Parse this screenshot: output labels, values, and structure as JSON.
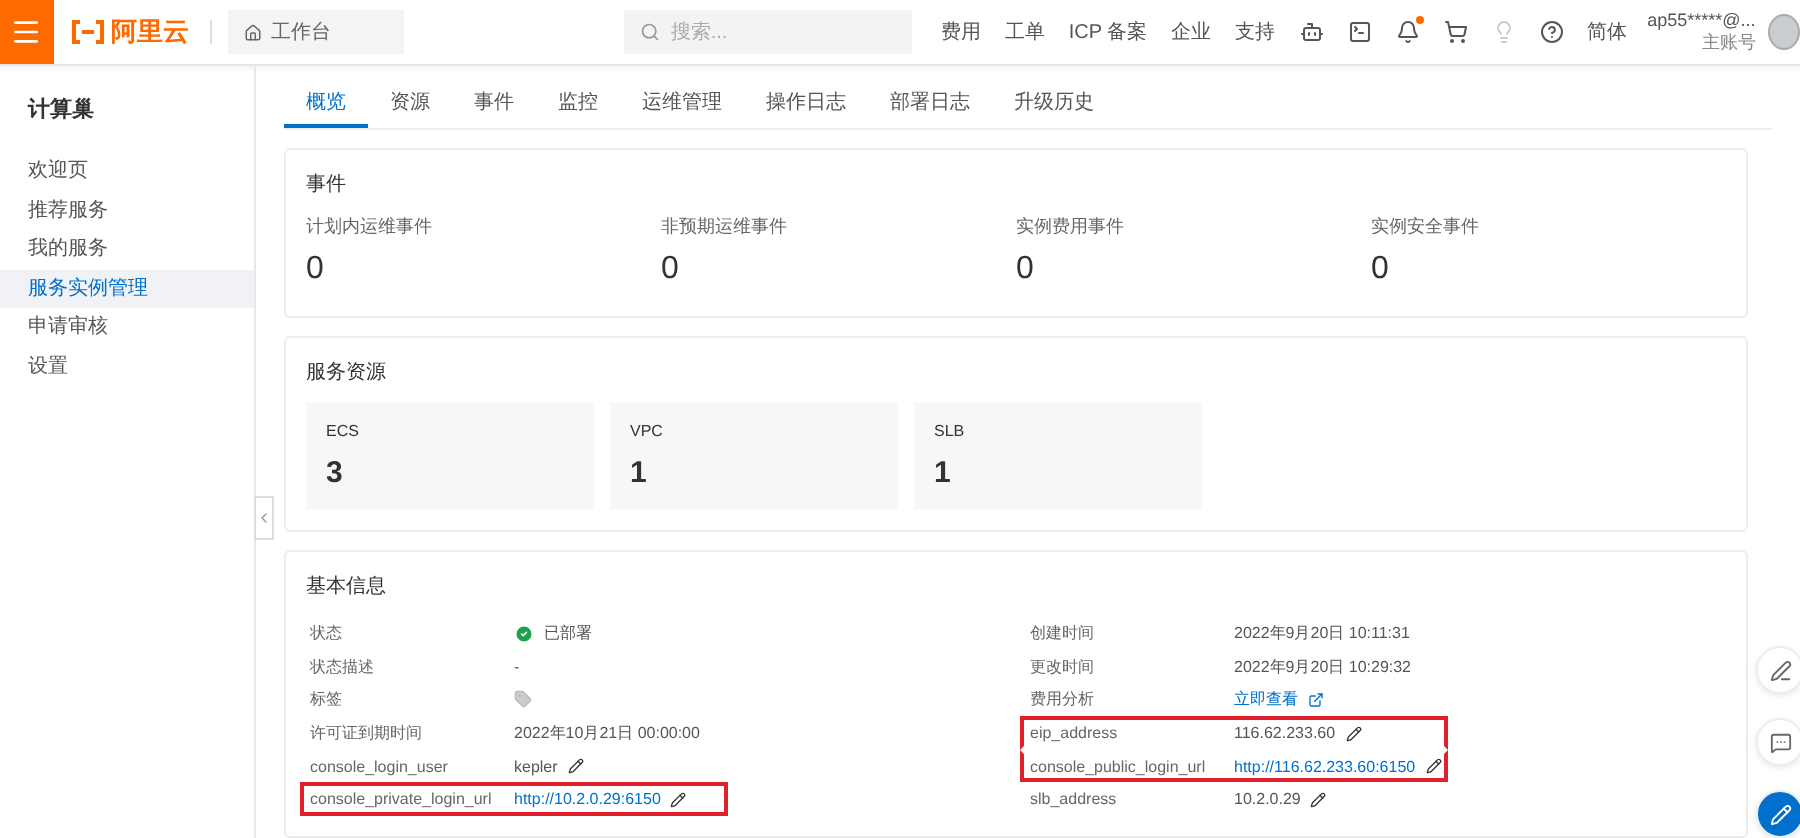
{
  "topbar": {
    "logo": "阿里云",
    "workspace": "工作台",
    "search": {
      "placeholder": "搜索..."
    },
    "nav": [
      "费用",
      "工单",
      "ICP 备案",
      "企业",
      "支持"
    ],
    "language": "简体",
    "notification_dot": true,
    "account": {
      "name": "ap55*****@...",
      "role": "主账号"
    }
  },
  "sidebar": {
    "title": "计算巢",
    "items": [
      {
        "label": "欢迎页",
        "selected": false
      },
      {
        "label": "推荐服务",
        "selected": false
      },
      {
        "label": "我的服务",
        "selected": false
      },
      {
        "label": "服务实例管理",
        "selected": true
      },
      {
        "label": "申请审核",
        "selected": false
      },
      {
        "label": "设置",
        "selected": false
      }
    ]
  },
  "tabs": [
    {
      "label": "概览",
      "selected": true
    },
    {
      "label": "资源",
      "selected": false
    },
    {
      "label": "事件",
      "selected": false
    },
    {
      "label": "监控",
      "selected": false
    },
    {
      "label": "运维管理",
      "selected": false
    },
    {
      "label": "操作日志",
      "selected": false
    },
    {
      "label": "部署日志",
      "selected": false
    },
    {
      "label": "升级历史",
      "selected": false
    }
  ],
  "events": {
    "title": "事件",
    "items": [
      {
        "label": "计划内运维事件",
        "value": "0"
      },
      {
        "label": "非预期运维事件",
        "value": "0"
      },
      {
        "label": "实例费用事件",
        "value": "0"
      },
      {
        "label": "实例安全事件",
        "value": "0"
      }
    ]
  },
  "resources": {
    "title": "服务资源",
    "items": [
      {
        "label": "ECS",
        "value": "3"
      },
      {
        "label": "VPC",
        "value": "1"
      },
      {
        "label": "SLB",
        "value": "1"
      }
    ]
  },
  "basic_info": {
    "title": "基本信息",
    "columns": [
      [
        {
          "label": "状态",
          "kind": "status",
          "value": "已部署",
          "highlighted": false
        },
        {
          "label": "状态描述",
          "kind": "text",
          "value": "-",
          "highlighted": false
        },
        {
          "label": "标签",
          "kind": "tag",
          "highlighted": false
        },
        {
          "label": "许可证到期时间",
          "kind": "text",
          "value": "2022年10月21日 00:00:00",
          "highlighted": false
        },
        {
          "label": "console_login_user",
          "kind": "editable",
          "value": "kepler",
          "highlighted": false
        },
        {
          "label": "console_private_login_url",
          "kind": "editable_link",
          "value": "http://10.2.0.29:6150",
          "highlighted": true
        }
      ],
      [
        {
          "label": "创建时间",
          "kind": "text",
          "value": "2022年9月20日 10:11:31",
          "highlighted": false
        },
        {
          "label": "更改时间",
          "kind": "text",
          "value": "2022年9月20日 10:29:32",
          "highlighted": false
        },
        {
          "label": "费用分析",
          "kind": "external_link",
          "value": "立即查看",
          "highlighted": false
        },
        {
          "label": "eip_address",
          "kind": "editable",
          "value": "116.62.233.60",
          "highlighted": true
        },
        {
          "label": "console_public_login_url",
          "kind": "editable_link",
          "value": "http://116.62.233.60:6150",
          "highlighted": true
        },
        {
          "label": "slb_address",
          "kind": "editable",
          "value": "10.2.0.29",
          "highlighted": false
        }
      ]
    ]
  }
}
